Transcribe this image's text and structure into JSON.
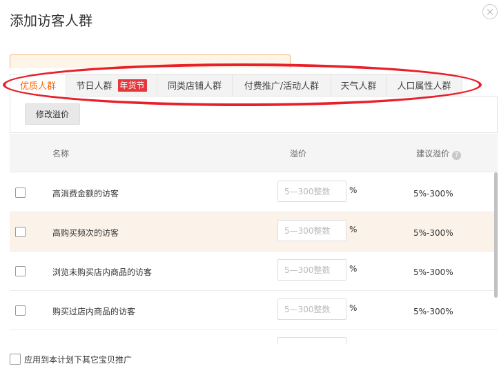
{
  "dialog": {
    "title": "添加访客人群",
    "close_symbol": "×"
  },
  "tabs": [
    {
      "label": "优质人群",
      "active": true
    },
    {
      "label": "节日人群",
      "badge": "年货节",
      "active": false
    },
    {
      "label": "同类店铺人群",
      "active": false
    },
    {
      "label": "付费推广/活动人群",
      "active": false
    },
    {
      "label": "天气人群",
      "active": false
    },
    {
      "label": "人口属性人群",
      "active": false
    }
  ],
  "toolbar": {
    "modify_label": "修改溢价"
  },
  "table": {
    "headers": {
      "name": "名称",
      "premium": "溢价",
      "suggested": "建议溢价",
      "help_symbol": "?"
    },
    "input_placeholder": "5—300整数",
    "percent_symbol": "%",
    "rows": [
      {
        "name": "高消费金额的访客",
        "suggested": "5%-300%",
        "highlight": false
      },
      {
        "name": "高购买频次的访客",
        "suggested": "5%-300%",
        "highlight": true
      },
      {
        "name": "浏览未购买店内商品的访客",
        "suggested": "5%-300%",
        "highlight": false
      },
      {
        "name": "购买过店内商品的访客",
        "suggested": "5%-300%",
        "highlight": false
      }
    ]
  },
  "footer": {
    "apply_label": "应用到本计划下其它宝贝推广"
  },
  "colors": {
    "accent_orange": "#ff6600",
    "badge_red": "#e4393c",
    "annotation_red": "#e8202a",
    "row_highlight": "#fbf3ea"
  }
}
